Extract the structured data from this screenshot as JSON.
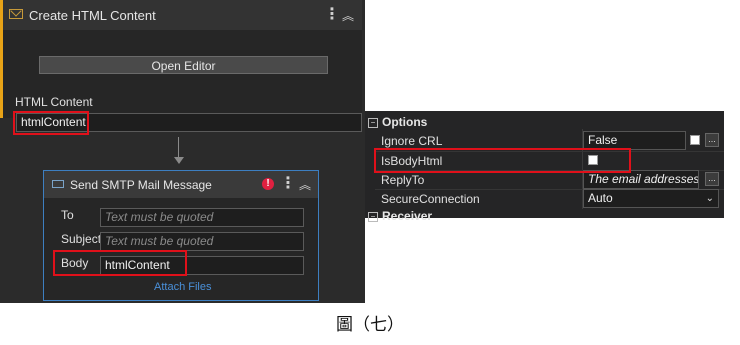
{
  "create_html": {
    "title": "Create HTML Content",
    "open_editor_label": "Open Editor",
    "html_content_label": "HTML Content",
    "html_content_value": "htmlContent"
  },
  "send_smtp": {
    "title": "Send SMTP Mail Message",
    "to_label": "To",
    "to_placeholder": "Text must be quoted",
    "subject_label": "Subject",
    "subject_placeholder": "Text must be quoted",
    "body_label": "Body",
    "body_value": "htmlContent",
    "attach_files_label": "Attach Files",
    "error_badge": "!"
  },
  "properties": {
    "options_section": "Options",
    "receiver_section": "Receiver",
    "rows": [
      {
        "name": "Ignore CRL",
        "value": "False"
      },
      {
        "name": "IsBodyHtml",
        "value": ""
      },
      {
        "name": "ReplyTo",
        "value": "The email addresses to"
      },
      {
        "name": "SecureConnection",
        "value": "Auto"
      }
    ],
    "ellipsis": "..."
  },
  "caption": "圖（七）",
  "colors": {
    "highlight": "#e0101a",
    "accent": "#e8a317",
    "selected_border": "#3d7fc1",
    "link": "#4a90d9"
  }
}
